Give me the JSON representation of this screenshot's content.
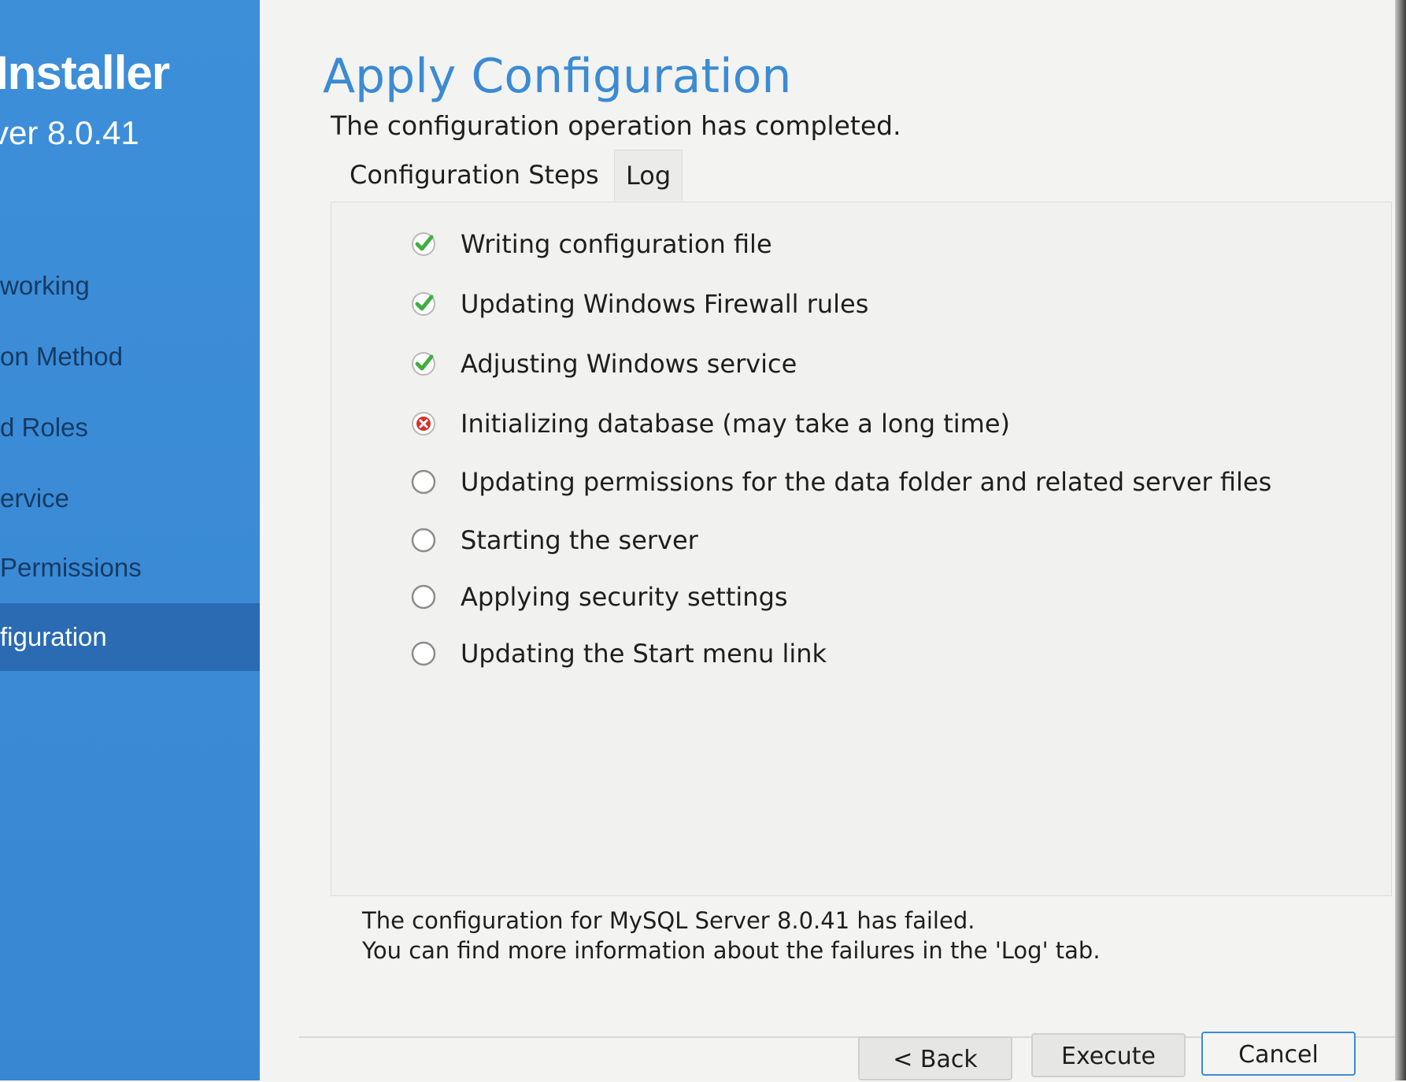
{
  "sidebar": {
    "brand": "Installer",
    "version": "ver 8.0.41",
    "items": [
      {
        "label": "working"
      },
      {
        "label": "on Method"
      },
      {
        "label": "d Roles"
      },
      {
        "label": "ervice"
      },
      {
        "label": "Permissions"
      },
      {
        "label": "figuration"
      }
    ],
    "active_index": 5
  },
  "main": {
    "title": "Apply Configuration",
    "subtitle": "The configuration operation has completed.",
    "tabs": [
      {
        "label": "Configuration Steps",
        "selected": true
      },
      {
        "label": "Log",
        "selected": false
      }
    ],
    "steps": [
      {
        "label": "Writing configuration file",
        "status": "success",
        "icon": "check-circle-icon"
      },
      {
        "label": "Updating Windows Firewall rules",
        "status": "success",
        "icon": "check-circle-icon"
      },
      {
        "label": "Adjusting Windows service",
        "status": "success",
        "icon": "check-circle-icon"
      },
      {
        "label": "Initializing database (may take a long time)",
        "status": "error",
        "icon": "error-circle-icon"
      },
      {
        "label": "Updating permissions for the data folder and related server files",
        "status": "pending",
        "icon": "empty-circle-icon"
      },
      {
        "label": "Starting the server",
        "status": "pending",
        "icon": "empty-circle-icon"
      },
      {
        "label": "Applying security settings",
        "status": "pending",
        "icon": "empty-circle-icon"
      },
      {
        "label": "Updating the Start menu link",
        "status": "pending",
        "icon": "empty-circle-icon"
      }
    ],
    "message_line1": "The configuration for MySQL Server 8.0.41 has failed.",
    "message_line2": "You can find more information about the failures in the 'Log' tab."
  },
  "buttons": {
    "back": "< Back",
    "execute": "Execute",
    "cancel": "Cancel"
  },
  "colors": {
    "sidebar": "#3a8ad6",
    "sidebar_active": "#2a6bb3",
    "title": "#3b8bd3",
    "success": "#3fae3f",
    "error": "#d6302f"
  }
}
